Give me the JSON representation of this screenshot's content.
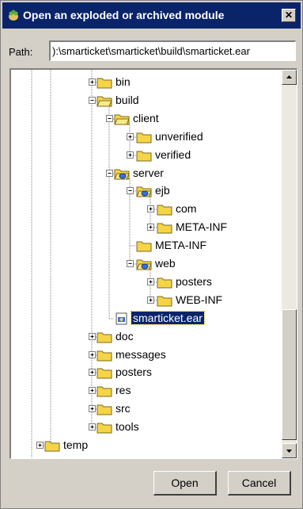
{
  "window": {
    "title": "Open an exploded or archived module",
    "close_glyph": "✕"
  },
  "path": {
    "label": "Path:",
    "value": "):\\smarticket\\smarticket\\build\\smarticket.ear"
  },
  "tree": {
    "nodes": [
      {
        "label": "bin",
        "level": 0,
        "expander": "plus",
        "icon": "folder-icon"
      },
      {
        "label": "build",
        "level": 0,
        "expander": "minus",
        "icon": "folder-open-icon"
      },
      {
        "label": "client",
        "level": 1,
        "expander": "minus",
        "icon": "folder-open-icon"
      },
      {
        "label": "unverified",
        "level": 2,
        "expander": "plus",
        "icon": "folder-icon"
      },
      {
        "label": "verified",
        "level": 2,
        "expander": "plus",
        "icon": "folder-icon"
      },
      {
        "label": "server",
        "level": 1,
        "expander": "minus",
        "icon": "module-folder-icon"
      },
      {
        "label": "ejb",
        "level": 2,
        "expander": "minus",
        "icon": "module-folder-icon"
      },
      {
        "label": "com",
        "level": 3,
        "expander": "plus",
        "icon": "folder-icon"
      },
      {
        "label": "META-INF",
        "level": 3,
        "expander": "plus",
        "icon": "folder-icon"
      },
      {
        "label": "META-INF",
        "level": 2,
        "expander": "none",
        "icon": "folder-icon"
      },
      {
        "label": "web",
        "level": 2,
        "expander": "minus",
        "icon": "module-folder-icon"
      },
      {
        "label": "posters",
        "level": 3,
        "expander": "plus",
        "icon": "folder-icon"
      },
      {
        "label": "WEB-INF",
        "level": 3,
        "expander": "plus",
        "icon": "folder-icon"
      },
      {
        "label": "smarticket.ear",
        "level": 1,
        "expander": "none",
        "icon": "ear-file-icon",
        "selected": true
      },
      {
        "label": "doc",
        "level": 0,
        "expander": "plus",
        "icon": "folder-icon"
      },
      {
        "label": "messages",
        "level": 0,
        "expander": "plus",
        "icon": "folder-icon"
      },
      {
        "label": "posters",
        "level": 0,
        "expander": "plus",
        "icon": "folder-icon"
      },
      {
        "label": "res",
        "level": 0,
        "expander": "plus",
        "icon": "folder-icon"
      },
      {
        "label": "src",
        "level": 0,
        "expander": "plus",
        "icon": "folder-icon"
      },
      {
        "label": "tools",
        "level": 0,
        "expander": "plus",
        "icon": "folder-icon"
      },
      {
        "label": "temp",
        "level": -1,
        "expander": "plus",
        "icon": "folder-icon"
      }
    ]
  },
  "buttons": {
    "open": "Open",
    "cancel": "Cancel"
  },
  "colors": {
    "titlebar": "#0a246a",
    "dialog": "#d4d0c8",
    "folder": "#f5d547",
    "selection": "#0a246a"
  }
}
